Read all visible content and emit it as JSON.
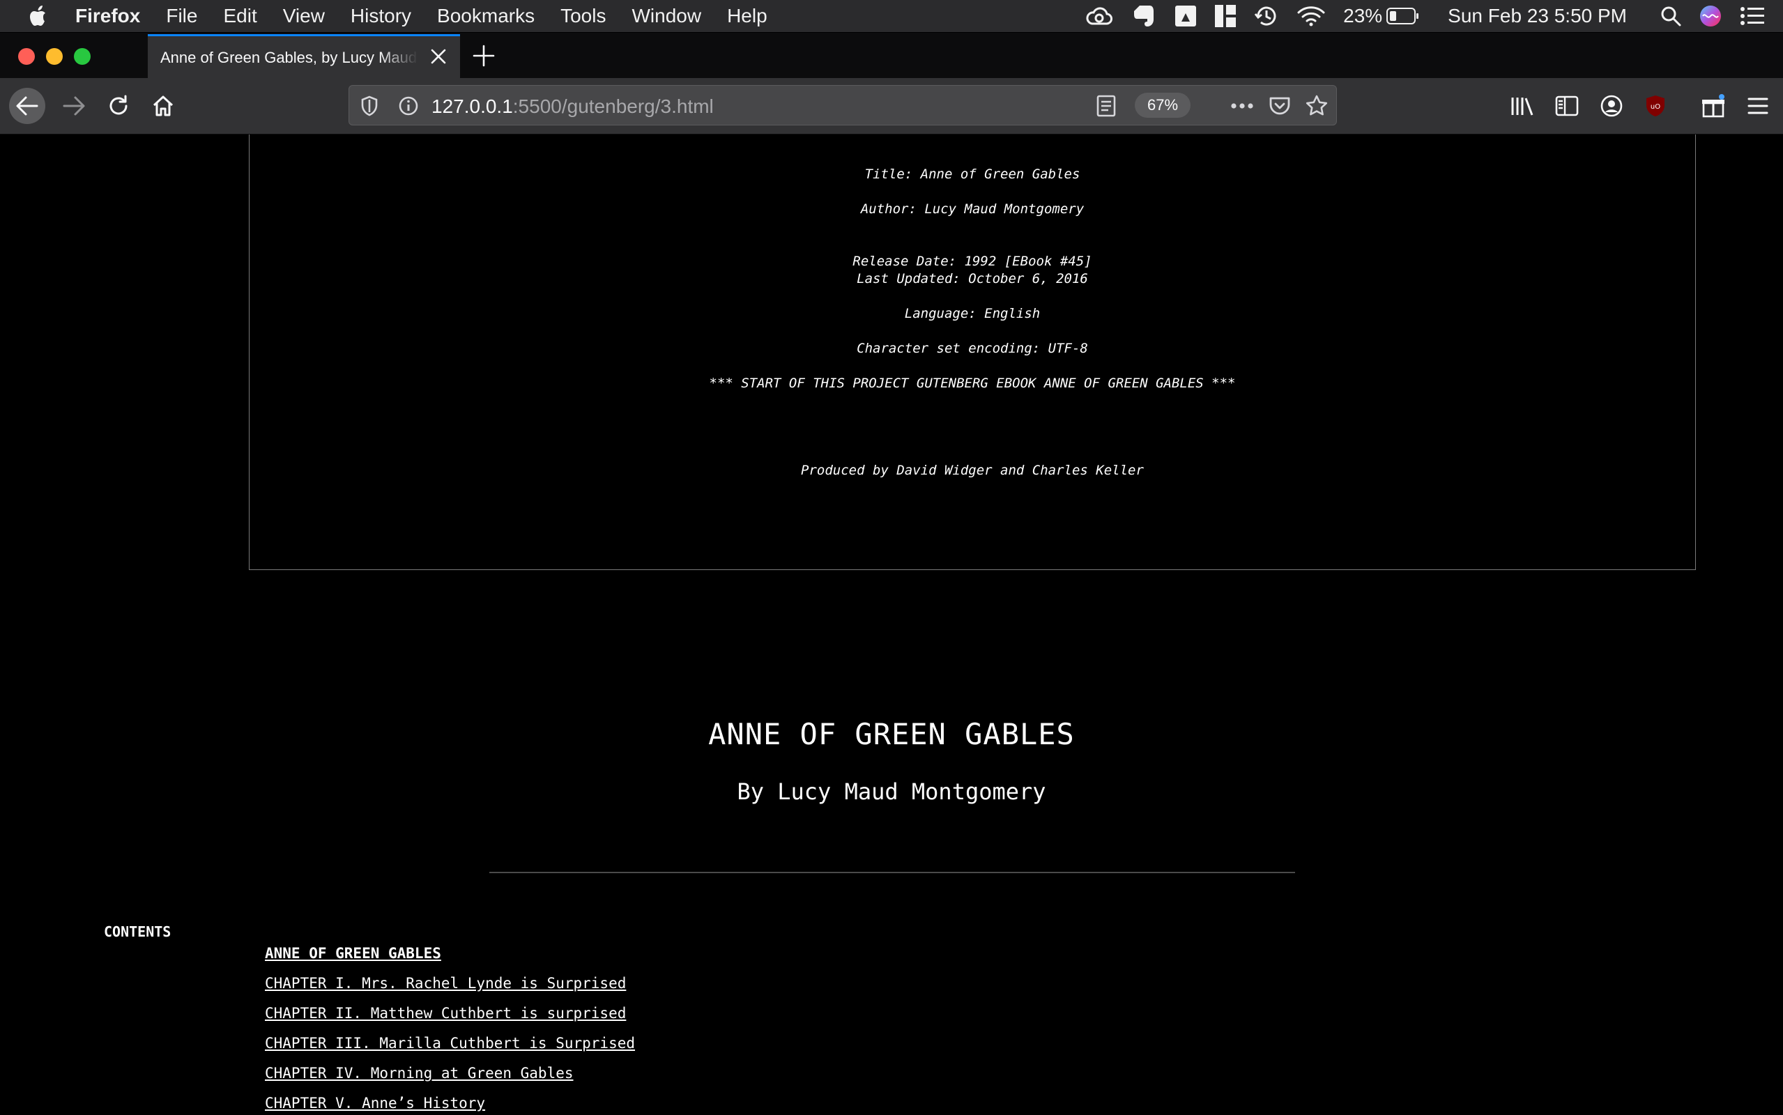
{
  "menubar": {
    "app": "Firefox",
    "items": [
      "File",
      "Edit",
      "View",
      "History",
      "Bookmarks",
      "Tools",
      "Window",
      "Help"
    ],
    "battery": "23%",
    "clock": "Sun Feb 23  5:50 PM"
  },
  "tab": {
    "title": "Anne of Green Gables, by Lucy Maud Montgomery"
  },
  "urlbar": {
    "host": "127.0.0.1",
    "path": ":5500/gutenberg/3.html",
    "zoom": "67%"
  },
  "header": {
    "title": "Title: Anne of Green Gables",
    "author": "Author: Lucy Maud Montgomery",
    "release": "Release Date: 1992 [EBook #45]",
    "updated": "Last Updated: October 6, 2016",
    "language": "Language: English",
    "encoding": "Character set encoding: UTF-8",
    "start": "*** START OF THIS PROJECT GUTENBERG EBOOK ANNE OF GREEN GABLES ***",
    "produced": "Produced by David Widger and Charles Keller"
  },
  "book": {
    "title": "ANNE OF GREEN GABLES",
    "byline": "By Lucy Maud Montgomery"
  },
  "contents": {
    "label": "CONTENTS",
    "items": [
      "ANNE OF GREEN GABLES",
      "CHAPTER I. Mrs. Rachel Lynde is Surprised",
      "CHAPTER II. Matthew Cuthbert is surprised",
      "CHAPTER III. Marilla Cuthbert is Surprised",
      "CHAPTER IV. Morning at Green Gables",
      "CHAPTER V. Anne’s History"
    ]
  }
}
